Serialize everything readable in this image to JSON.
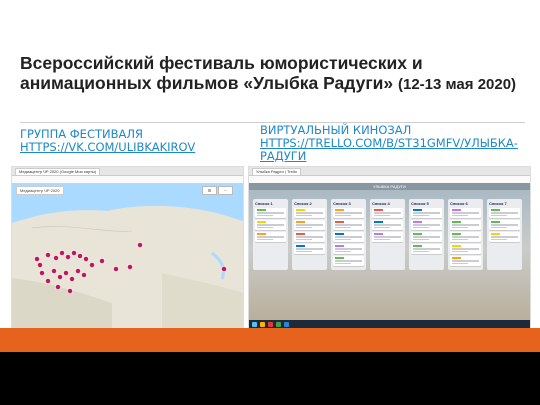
{
  "slide": {
    "title": "Всероссийский фестиваль юмористических и анимационных фильмов «Улыбка Радуги»",
    "dates": "(12-13 мая 2020)"
  },
  "left_link": {
    "heading": "Группа фестиваля",
    "url": "https://vk.com/ulibkakirov"
  },
  "right_link": {
    "heading": "Виртуальный кинозал",
    "url": "https://trello.com/b/St31GmfV/улыбка-радуги"
  },
  "map_screenshot": {
    "tab_label": "Медиацентр ЧР 2020 (Google Мои карты)",
    "toolbar": "Медиацентр ЧР 2020",
    "marker_color": "#c2185b"
  },
  "trello_screenshot": {
    "board_title": "УЛЫБКА РАДУГИ",
    "tab_label": "Улыбка Радуги | Trello",
    "lists": [
      "Список 1",
      "Список 2",
      "Список 3",
      "Список 4",
      "Список 5",
      "Список 6",
      "Список 7"
    ]
  },
  "colors": {
    "accent": "#1e88c8",
    "footer": "#e5631d"
  }
}
